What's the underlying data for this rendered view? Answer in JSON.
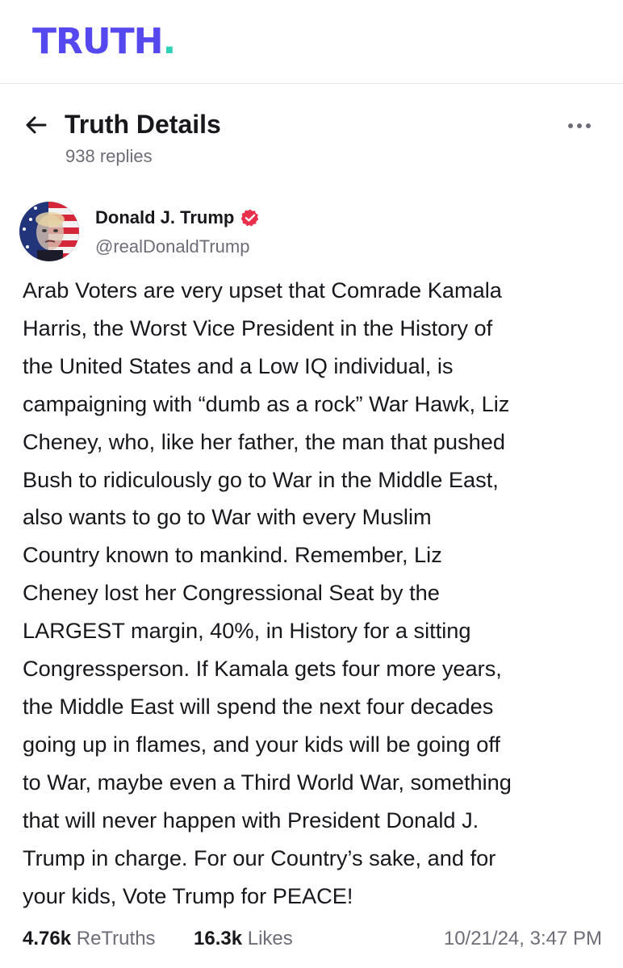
{
  "app": {
    "logo_text": "TRUTH",
    "logo_dot": ".",
    "brand_color": "#5448ee",
    "accent_color": "#2ed3b7"
  },
  "header": {
    "back_icon": "arrow-left-icon",
    "title": "Truth Details",
    "replies": "938 replies",
    "more_icon": "more-horizontal-icon"
  },
  "post": {
    "author": {
      "name": "Donald J. Trump",
      "handle": "@realDonaldTrump",
      "verified": true,
      "verified_icon": "verified-badge-icon",
      "verified_color": "#e8304d",
      "avatar": "avatar-image"
    },
    "lines": [
      "Arab Voters are very upset that Comrade Kamala",
      "Harris, the Worst Vice President in the History of",
      "the United States and a Low IQ individual, is",
      "campaigning with “dumb as a rock” War Hawk, Liz",
      "Cheney, who, like her father, the man that pushed",
      "Bush to ridiculously go to War in the Middle East,",
      "also wants to go to War with every Muslim",
      "Country known to mankind. Remember, Liz",
      "Cheney lost her Congressional Seat by the",
      "LARGEST margin, 40%, in History for a sitting",
      "Congressperson. If Kamala gets four more years,",
      "the Middle East will spend the next four decades",
      "going up in flames, and your kids will be going off",
      "to War, maybe even a Third World War, something",
      "that will never happen with President Donald J.",
      "Trump in charge. For our Country’s sake, and for",
      "your kids, Vote Trump for PEACE!"
    ],
    "stats": {
      "retruths_count": "4.76k",
      "retruths_label": "ReTruths",
      "likes_count": "16.3k",
      "likes_label": "Likes"
    },
    "timestamp": "10/21/24, 3:47 PM"
  }
}
